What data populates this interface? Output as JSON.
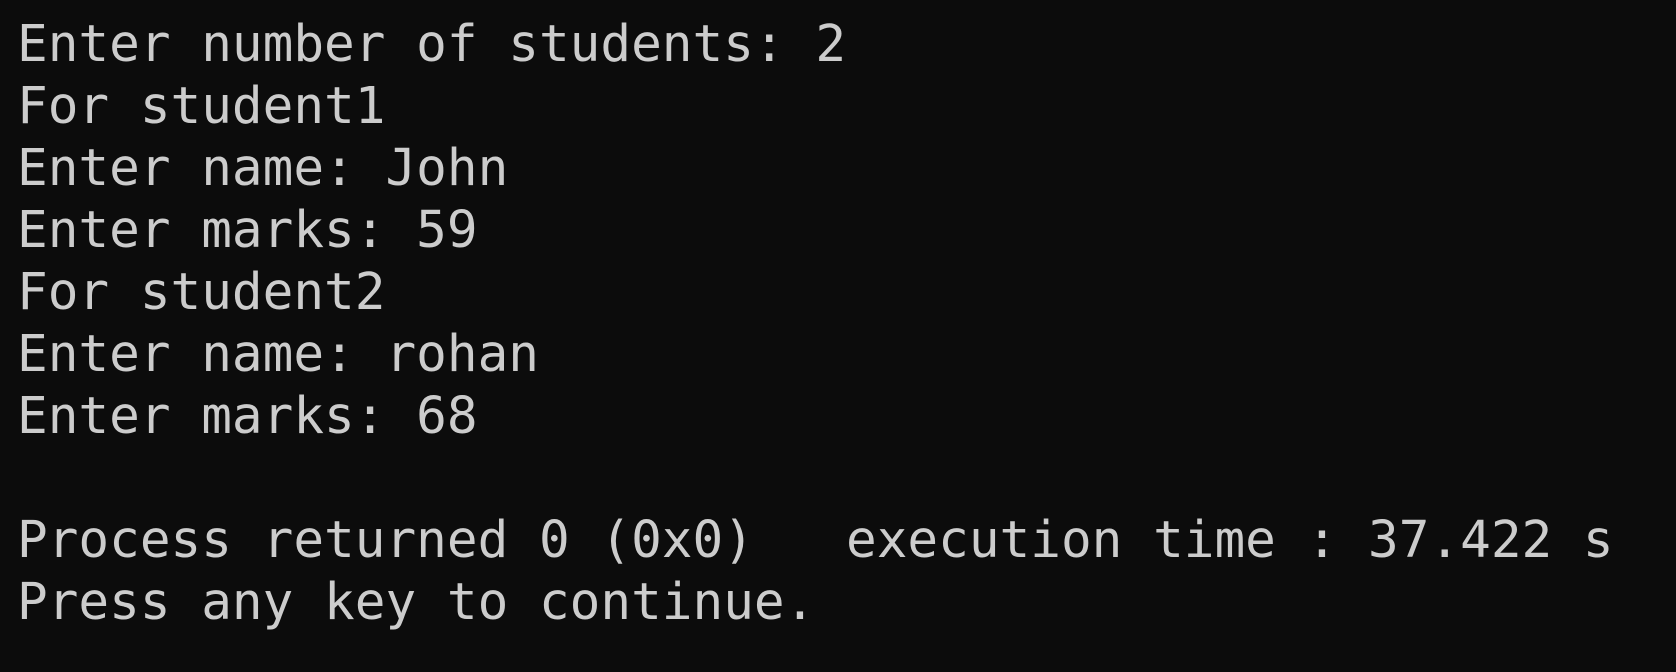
{
  "console": {
    "lines": [
      "Enter number of students: 2",
      "For student1",
      "Enter name: John",
      "Enter marks: 59",
      "For student2",
      "Enter name: rohan",
      "Enter marks: 68",
      "",
      "Process returned 0 (0x0)   execution time : 37.422 s",
      "Press any key to continue."
    ]
  },
  "colors": {
    "background": "#0c0c0c",
    "text": "#cccccc"
  }
}
